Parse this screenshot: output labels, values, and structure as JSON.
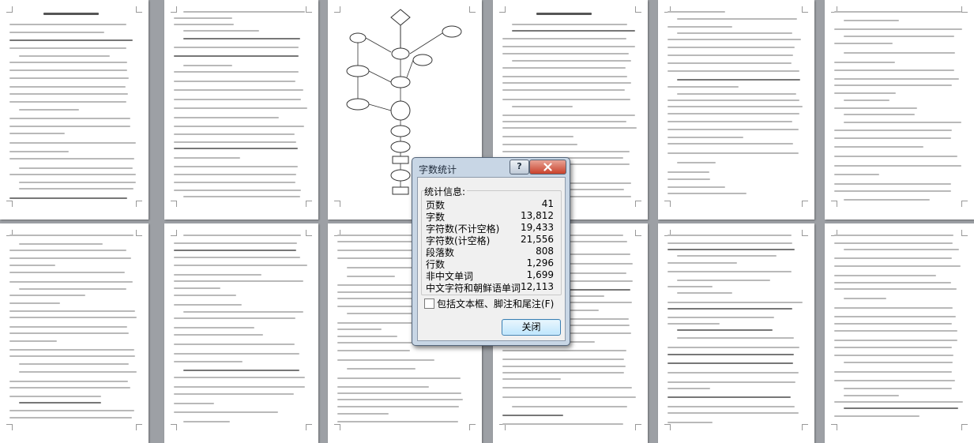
{
  "dialog": {
    "title": "字数统计",
    "help_label": "?",
    "close_icon": "close-x",
    "section_label": "统计信息:",
    "stats": [
      {
        "label": "页数",
        "value": "41"
      },
      {
        "label": "字数",
        "value": "13,812"
      },
      {
        "label": "字符数(不计空格)",
        "value": "19,433"
      },
      {
        "label": "字符数(计空格)",
        "value": "21,556"
      },
      {
        "label": "段落数",
        "value": "808"
      },
      {
        "label": "行数",
        "value": "1,296"
      },
      {
        "label": "非中文单词",
        "value": "1,699"
      },
      {
        "label": "中文字符和朝鲜语单词",
        "value": "12,113"
      }
    ],
    "checkbox_label": "包括文本框、脚注和尾注(F)",
    "checkbox_checked": false,
    "ok_label": "关闭",
    "colors": {
      "close_button": "#c9412b",
      "frame": "#c8d6e5"
    }
  },
  "document_pages": {
    "row_count": 2,
    "pages_per_row": 6
  }
}
